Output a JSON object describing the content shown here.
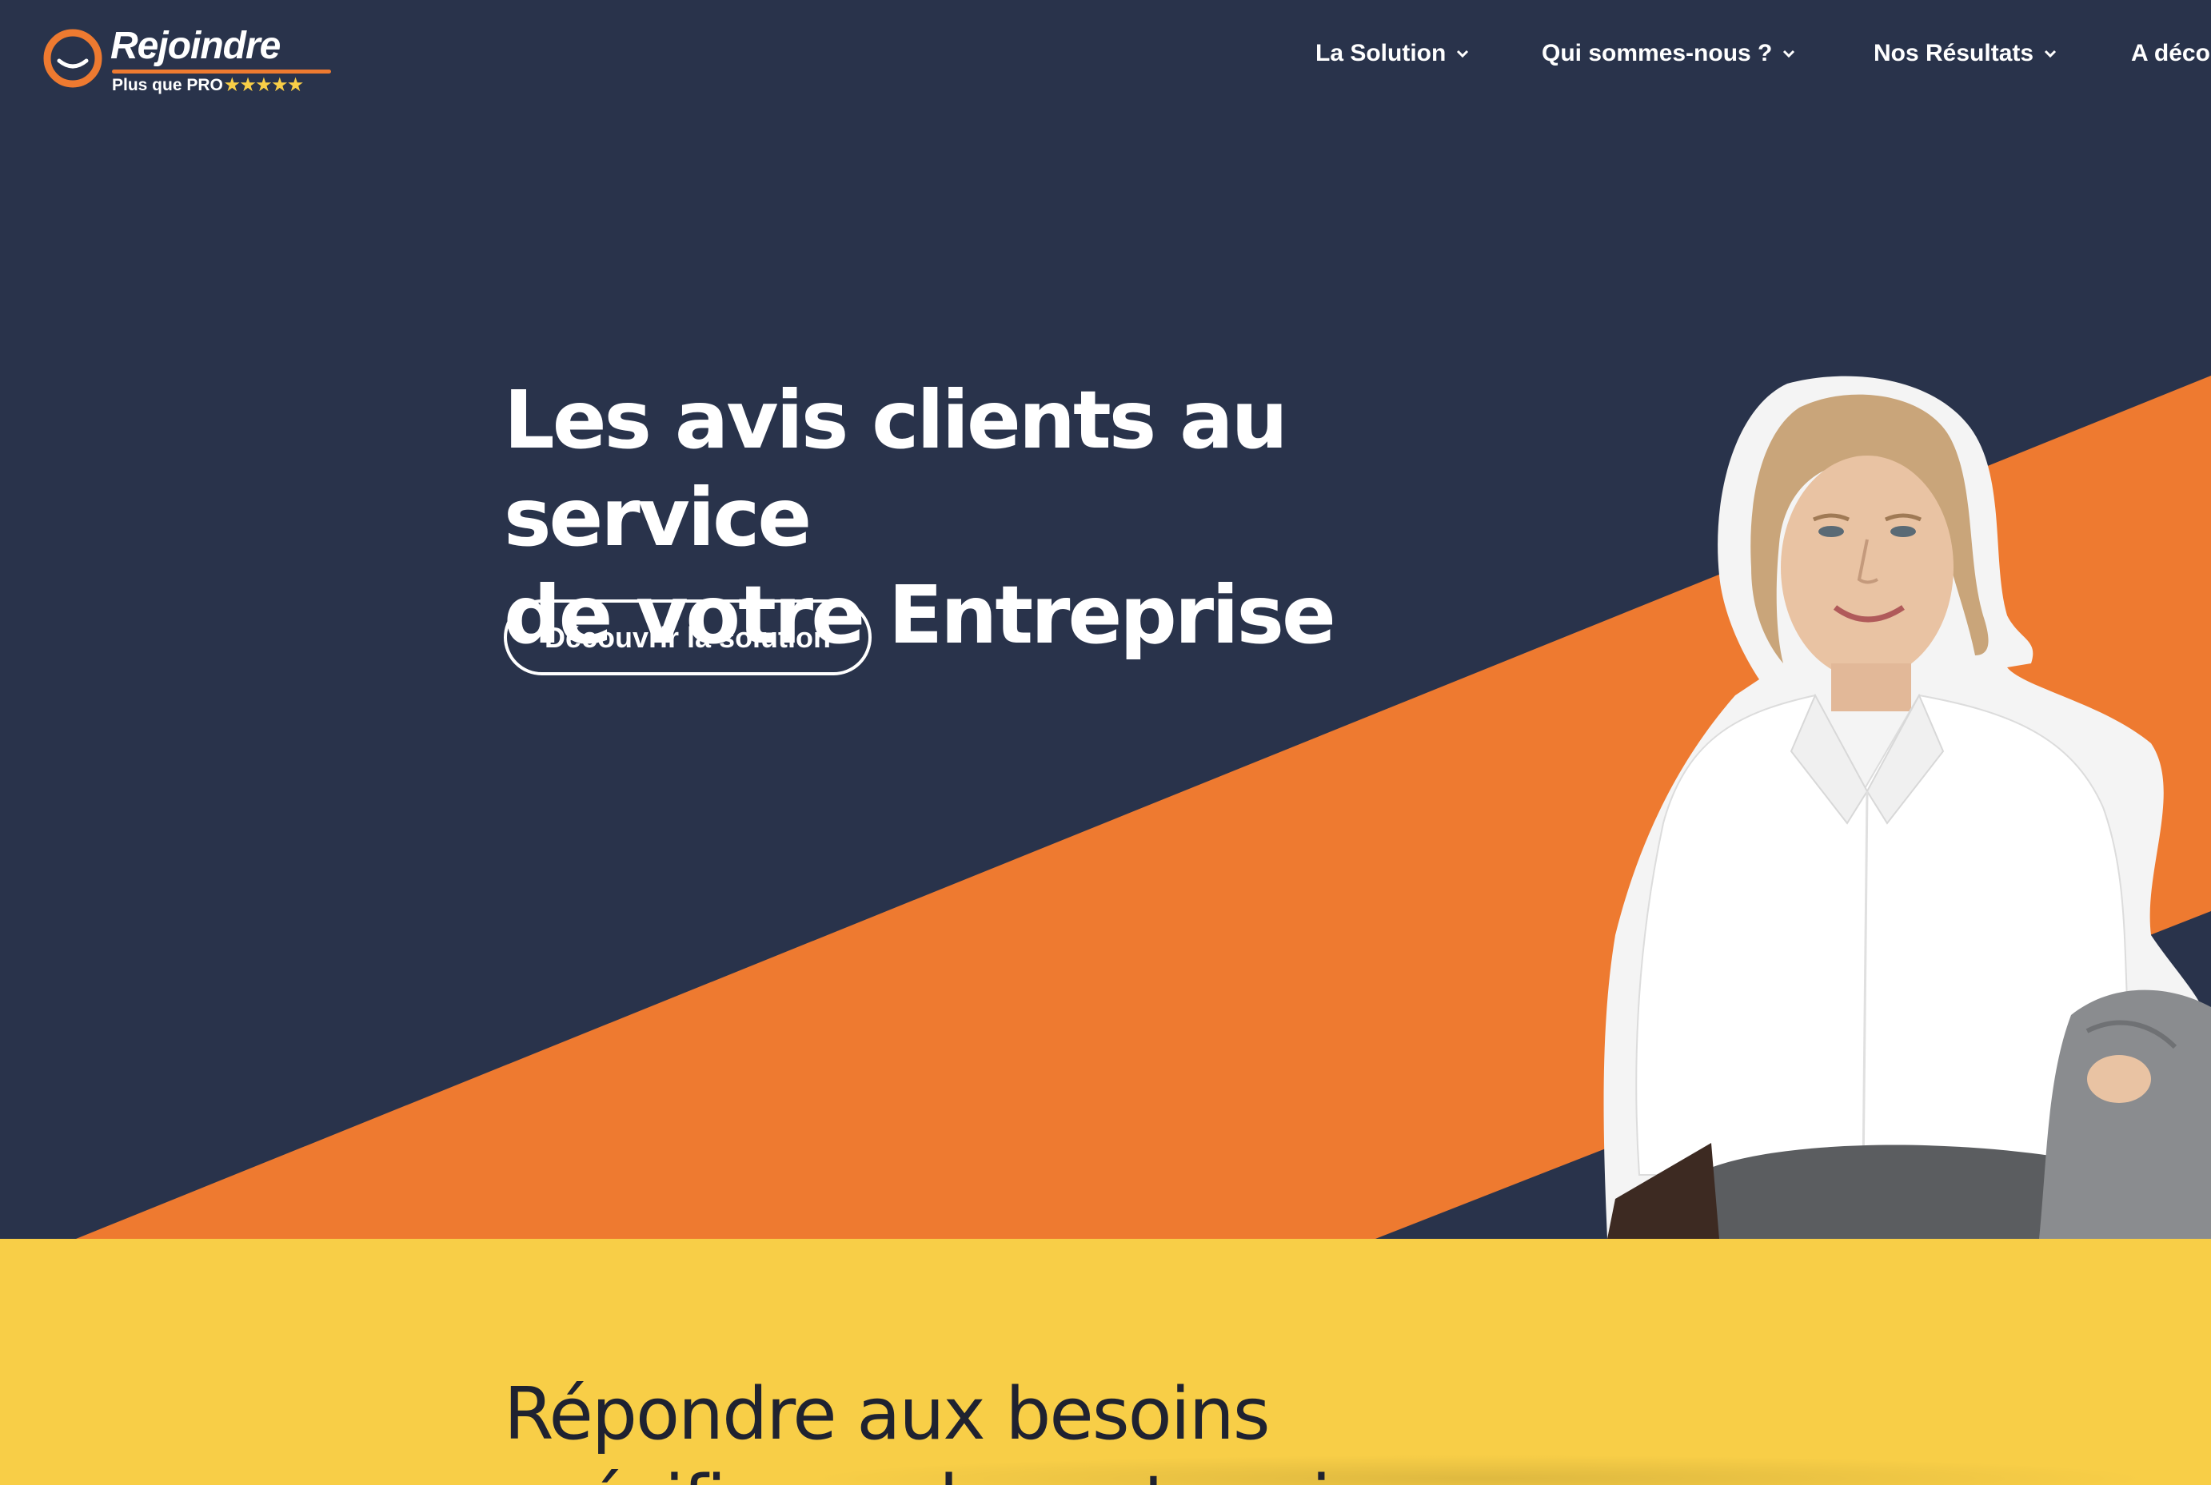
{
  "brand": {
    "name": "Rejoindre",
    "tagline": "Plus que PRO",
    "stars": "★★★★★",
    "colors": {
      "navy": "#29334b",
      "orange": "#ee7a30",
      "yellow": "#f8ce47"
    }
  },
  "nav": {
    "items": [
      {
        "label": "La Solution",
        "icon": "chevron-down-icon"
      },
      {
        "label": "Qui sommes-nous ?",
        "icon": "chevron-down-icon"
      },
      {
        "label": "Nos Résultats",
        "icon": "chevron-down-icon"
      },
      {
        "label": "A déco"
      }
    ]
  },
  "hero": {
    "title_line1": "Les avis clients au service",
    "title_line2": "de votre Entreprise",
    "cta_label": "Découvrir la solution"
  },
  "section": {
    "title_line1": "Répondre aux besoins",
    "title_line2": "spécifiques des entreprises"
  }
}
